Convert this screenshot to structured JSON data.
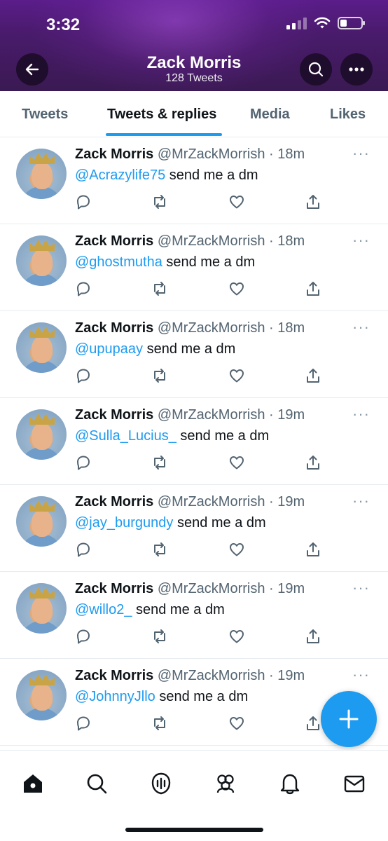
{
  "status_bar": {
    "time": "3:32"
  },
  "header": {
    "title": "Zack Morris",
    "subtitle": "128 Tweets"
  },
  "tabs": [
    {
      "label": "Tweets",
      "active": false
    },
    {
      "label": "Tweets & replies",
      "active": true
    },
    {
      "label": "Media",
      "active": false
    },
    {
      "label": "Likes",
      "active": false
    }
  ],
  "tweets": [
    {
      "name": "Zack Morris",
      "handle": "@MrZackMorrish",
      "time": "18m",
      "mention": "@Acrazylife75",
      "text": " send me a dm"
    },
    {
      "name": "Zack Morris",
      "handle": "@MrZackMorrish",
      "time": "18m",
      "mention": "@ghostmutha",
      "text": " send me a dm"
    },
    {
      "name": "Zack Morris",
      "handle": "@MrZackMorrish",
      "time": "18m",
      "mention": "@upupaay",
      "text": " send me a dm"
    },
    {
      "name": "Zack Morris",
      "handle": "@MrZackMorrish",
      "time": "19m",
      "mention": "@Sulla_Lucius_",
      "text": " send me a dm"
    },
    {
      "name": "Zack Morris",
      "handle": "@MrZackMorrish",
      "time": "19m",
      "mention": "@jay_burgundy",
      "text": " send me a dm"
    },
    {
      "name": "Zack Morris",
      "handle": "@MrZackMorrish",
      "time": "19m",
      "mention": "@willo2_",
      "text": " send me a dm"
    },
    {
      "name": "Zack Morris",
      "handle": "@MrZackMorrish",
      "time": "19m",
      "mention": "@JohnnyJllo",
      "text": " send me a dm"
    }
  ],
  "separator": " · ",
  "colors": {
    "accent": "#1d9bf0",
    "header_bg": "#4a1b6d",
    "secondary_text": "#536471"
  },
  "icons": {
    "back": "arrow-left-icon",
    "search": "search-icon",
    "more": "more-horizontal-icon",
    "reply": "reply-icon",
    "retweet": "retweet-icon",
    "like": "heart-icon",
    "share": "share-icon",
    "compose": "plus-icon",
    "home": "home-icon",
    "explore": "search-icon",
    "spaces": "spaces-icon",
    "communities": "communities-icon",
    "notifications": "bell-icon",
    "messages": "mail-icon"
  }
}
